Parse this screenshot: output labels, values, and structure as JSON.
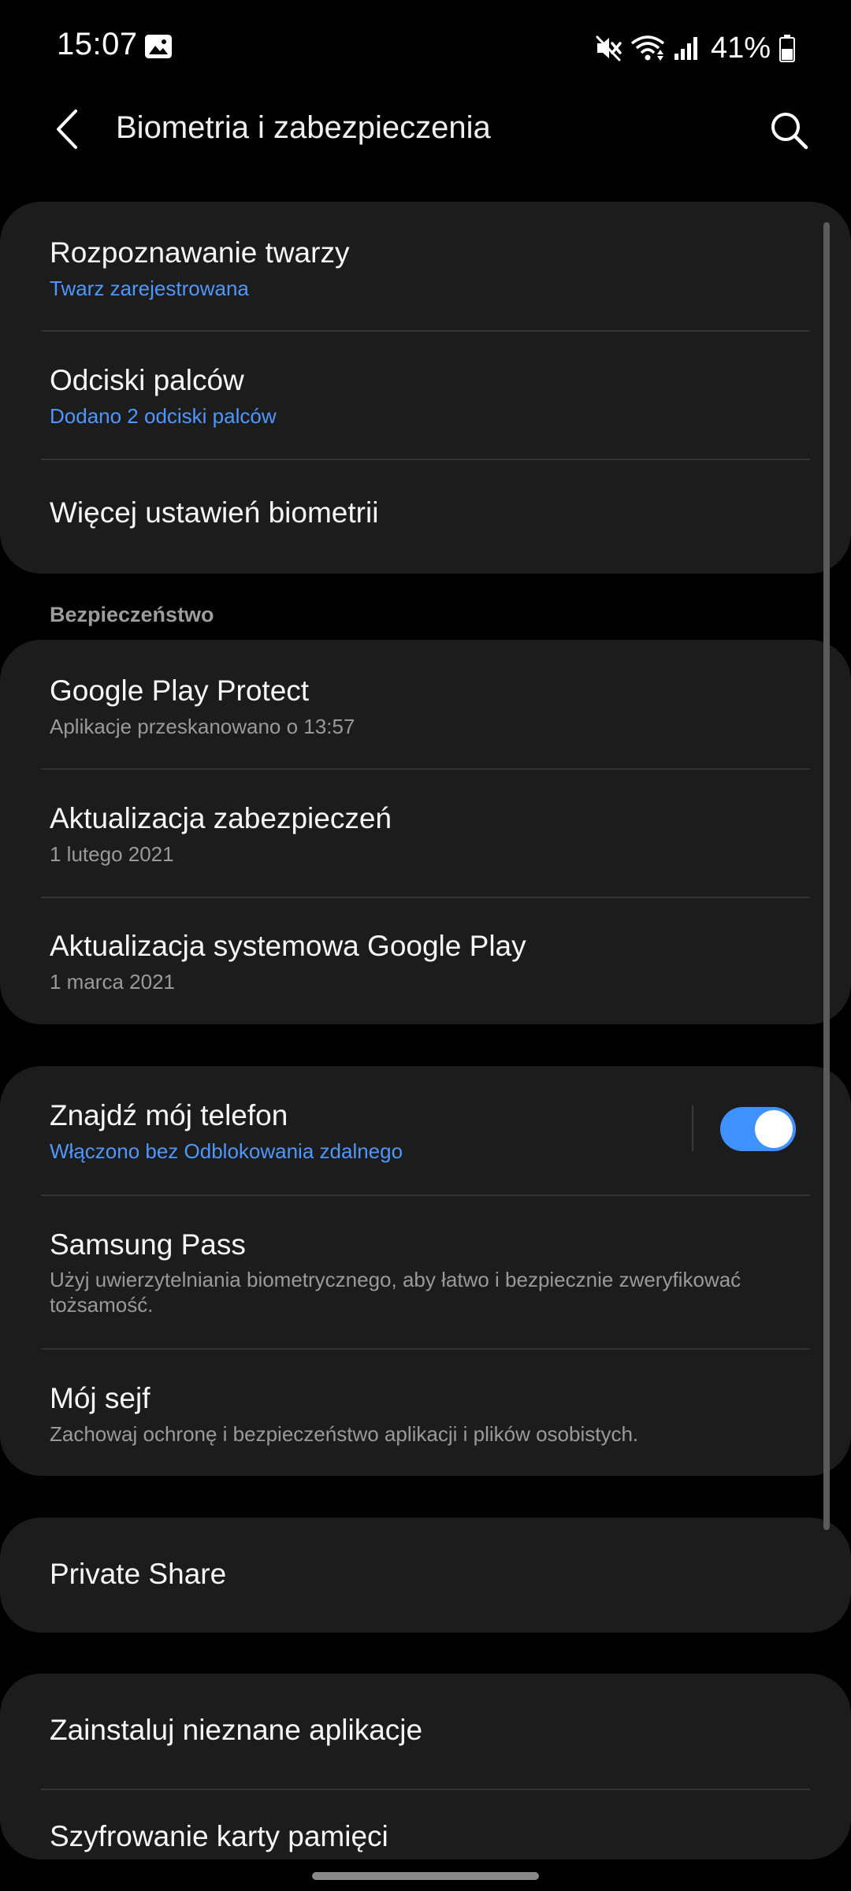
{
  "status_bar": {
    "time": "15:07",
    "battery": "41%",
    "icons": [
      "gallery-icon",
      "mute-icon",
      "wifi-icon",
      "signal-icon",
      "battery-icon"
    ]
  },
  "app_bar": {
    "title": "Biometria i zabezpieczenia",
    "back_icon": "back-arrow-icon",
    "search_icon": "search-icon"
  },
  "biometrics": {
    "items": [
      {
        "title": "Rozpoznawanie twarzy",
        "subtitle": "Twarz zarejestrowana"
      },
      {
        "title": "Odciski palców",
        "subtitle": "Dodano 2 odciski palców"
      },
      {
        "title": "Więcej ustawień biometrii"
      }
    ]
  },
  "security": {
    "header": "Bezpieczeństwo",
    "items": [
      {
        "title": "Google Play Protect",
        "subtitle": "Aplikacje przeskanowano o 13:57"
      },
      {
        "title": "Aktualizacja zabezpieczeń",
        "subtitle": "1 lutego 2021"
      },
      {
        "title": "Aktualizacja systemowa Google Play",
        "subtitle": "1 marca 2021"
      }
    ]
  },
  "device": {
    "items": [
      {
        "title": "Znajdź mój telefon",
        "subtitle": "Włączono bez Odblokowania zdalnego",
        "toggle_on": true
      },
      {
        "title": "Samsung Pass",
        "subtitle": "Użyj uwierzytelniania biometrycznego, aby łatwo i bezpiecznie zweryfikować tożsamość."
      },
      {
        "title": "Mój sejf",
        "subtitle": "Zachowaj ochronę i bezpieczeństwo aplikacji i plików osobistych."
      }
    ]
  },
  "share": {
    "items": [
      {
        "title": "Private Share"
      }
    ]
  },
  "other": {
    "items": [
      {
        "title": "Zainstaluj nieznane aplikacje"
      },
      {
        "title": "Szyfrowanie karty pamięci"
      }
    ]
  },
  "colors": {
    "background": "#000000",
    "card": "#1c1c1c",
    "accent": "#4e97ff",
    "toggle": "#3e91ff",
    "secondary_text": "#9a9a9a"
  }
}
